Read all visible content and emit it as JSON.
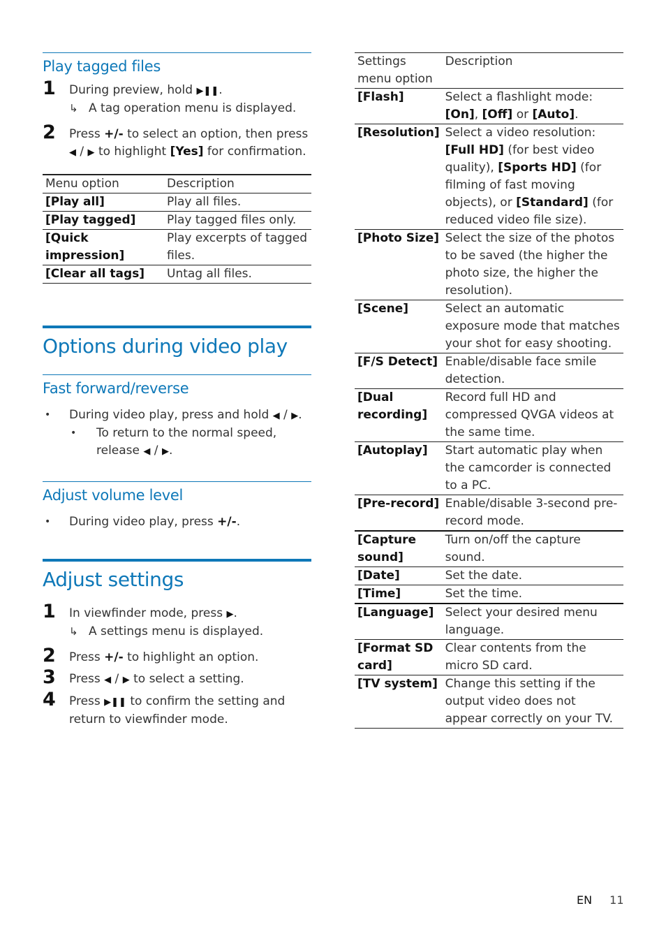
{
  "left": {
    "play_tagged": {
      "heading": "Play tagged files",
      "steps": [
        {
          "num": "1",
          "pre": "During preview, hold ",
          "icon": "play-pause-icon",
          "post": ".",
          "result": "A tag operation menu is displayed."
        },
        {
          "num": "2",
          "line1_pre": "Press ",
          "line1_key": "+/-",
          "line1_post": " to select an option, then press",
          "line2_post": " to highlight ",
          "line2_key": "[Yes]",
          "line2_end": " for confirmation."
        }
      ],
      "table": {
        "headers": [
          "Menu option",
          "Description"
        ],
        "rows": [
          {
            "option": "[Play all]",
            "description": "Play all files."
          },
          {
            "option": "[Play tagged]",
            "description": "Play tagged files only."
          },
          {
            "option": "[Quick impression]",
            "description": "Play excerpts of tagged files."
          },
          {
            "option": "[Clear all tags]",
            "description": "Untag all files."
          }
        ]
      }
    },
    "options_video": {
      "heading": "Options during video play",
      "fast_forward": {
        "heading": "Fast forward/reverse",
        "bullet1": "During video play, press and hold ",
        "bullet2_a": "To return to the normal speed,",
        "bullet2_b": "release "
      },
      "volume": {
        "heading": "Adjust volume level",
        "bullet_pre": "During video play, press ",
        "bullet_key": "+/-",
        "bullet_post": "."
      }
    },
    "adjust_settings": {
      "heading": "Adjust settings",
      "steps": [
        {
          "num": "1",
          "text": "In viewfinder mode, press ",
          "result": "A settings menu is displayed."
        },
        {
          "num": "2",
          "pre": "Press ",
          "key": "+/-",
          "post": " to highlight an option."
        },
        {
          "num": "3",
          "pre": "Press ",
          "post": " to select a setting."
        },
        {
          "num": "4",
          "pre": "Press ",
          "post": " to confirm the setting and return to viewfinder mode."
        }
      ]
    }
  },
  "right": {
    "settings_table": {
      "headers": [
        "Settings menu option",
        "Description"
      ],
      "rows": [
        {
          "option": "[Flash]",
          "description_html": "Select a flashlight mode: <b>[On]</b>, <b>[Off]</b> or <b>[Auto]</b>."
        },
        {
          "option": "[Resolution]",
          "description_html": "Select a video resolution: <b>[Full HD]</b> (for best video quality), <b>[Sports HD]</b> (for filming of fast moving objects), or <b>[Standard]</b> (for reduced video file size)."
        },
        {
          "option": "[Photo Size]",
          "description_html": "Select the size of the photos to be saved (the higher the photo size, the higher the resolution)."
        },
        {
          "option": "[Scene]",
          "description_html": "Select an automatic exposure mode that matches your shot for easy shooting."
        },
        {
          "option": "[F/S Detect]",
          "description_html": "Enable/disable face smile detection."
        },
        {
          "option": "[Dual recording]",
          "description_html": "Record full HD and compressed QVGA videos at the same time."
        },
        {
          "option": "[Autoplay]",
          "description_html": "Start automatic play when the camcorder is connected to a PC."
        },
        {
          "option": "[Pre-record]",
          "description_html": "Enable/disable 3-second pre-record mode."
        },
        {
          "option": "[Capture sound]",
          "description_html": "Turn on/off the capture sound."
        },
        {
          "option": "[Date]",
          "description_html": "Set the date."
        },
        {
          "option": "[Time]",
          "description_html": "Set the time."
        },
        {
          "option": "[Language]",
          "description_html": "Select your desired menu language."
        },
        {
          "option": "[Format SD card]",
          "description_html": "Clear contents from the micro SD card."
        },
        {
          "option": "[TV system]",
          "description_html": "Change this setting if the output video does not appear correctly on your TV."
        }
      ]
    }
  },
  "icons": {
    "play_pause": "▶❚❚",
    "left": "◀",
    "right": "▶",
    "slash": " / ",
    "result_arrow": "↳"
  },
  "footer": {
    "language": "EN",
    "page": "11"
  },
  "colors": {
    "accent": "#0e78b8"
  }
}
